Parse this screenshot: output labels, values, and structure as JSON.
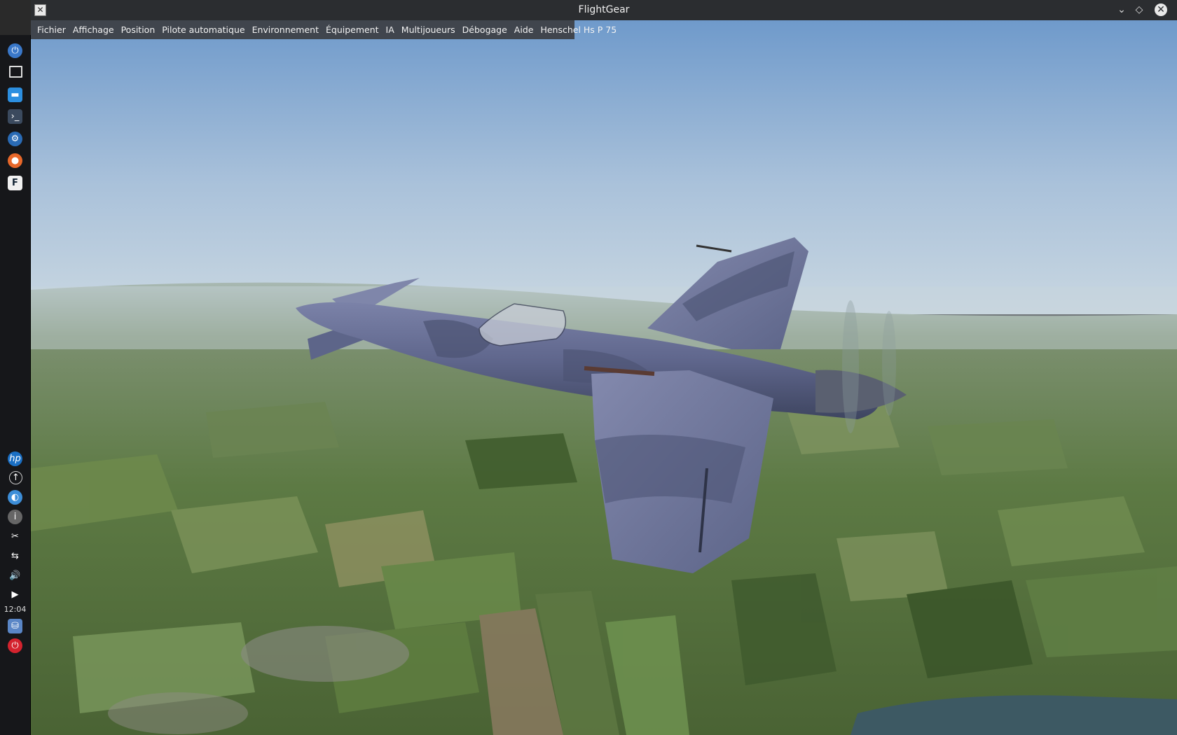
{
  "window": {
    "title": "FlightGear"
  },
  "menu": [
    "Fichier",
    "Affichage",
    "Position",
    "Pilote automatique",
    "Environnement",
    "Équipement",
    "IA",
    "Multijoueurs",
    "Débogage",
    "Aide",
    "Henschel Hs P 75"
  ],
  "dock": {
    "clock": "12:04",
    "top_icons": [
      "launcher-icon",
      "desktop-icon",
      "files-icon",
      "terminal-icon",
      "settings-icon",
      "firefox-icon",
      "flightgear-icon"
    ],
    "bottom_icons": [
      "hp-icon",
      "update-icon",
      "network-icon",
      "info-icon",
      "scissors-icon",
      "usb-icon",
      "volume-icon",
      "expand-icon"
    ],
    "tray_icons": [
      "drive-icon",
      "power-icon"
    ]
  },
  "colors": {
    "titlebar": "#2b2d30",
    "menubar": "#3c3e42",
    "dock": "#16171a",
    "sky_top": "#6f9acb",
    "haze": "#c3d3df",
    "ground": "#56703f"
  }
}
